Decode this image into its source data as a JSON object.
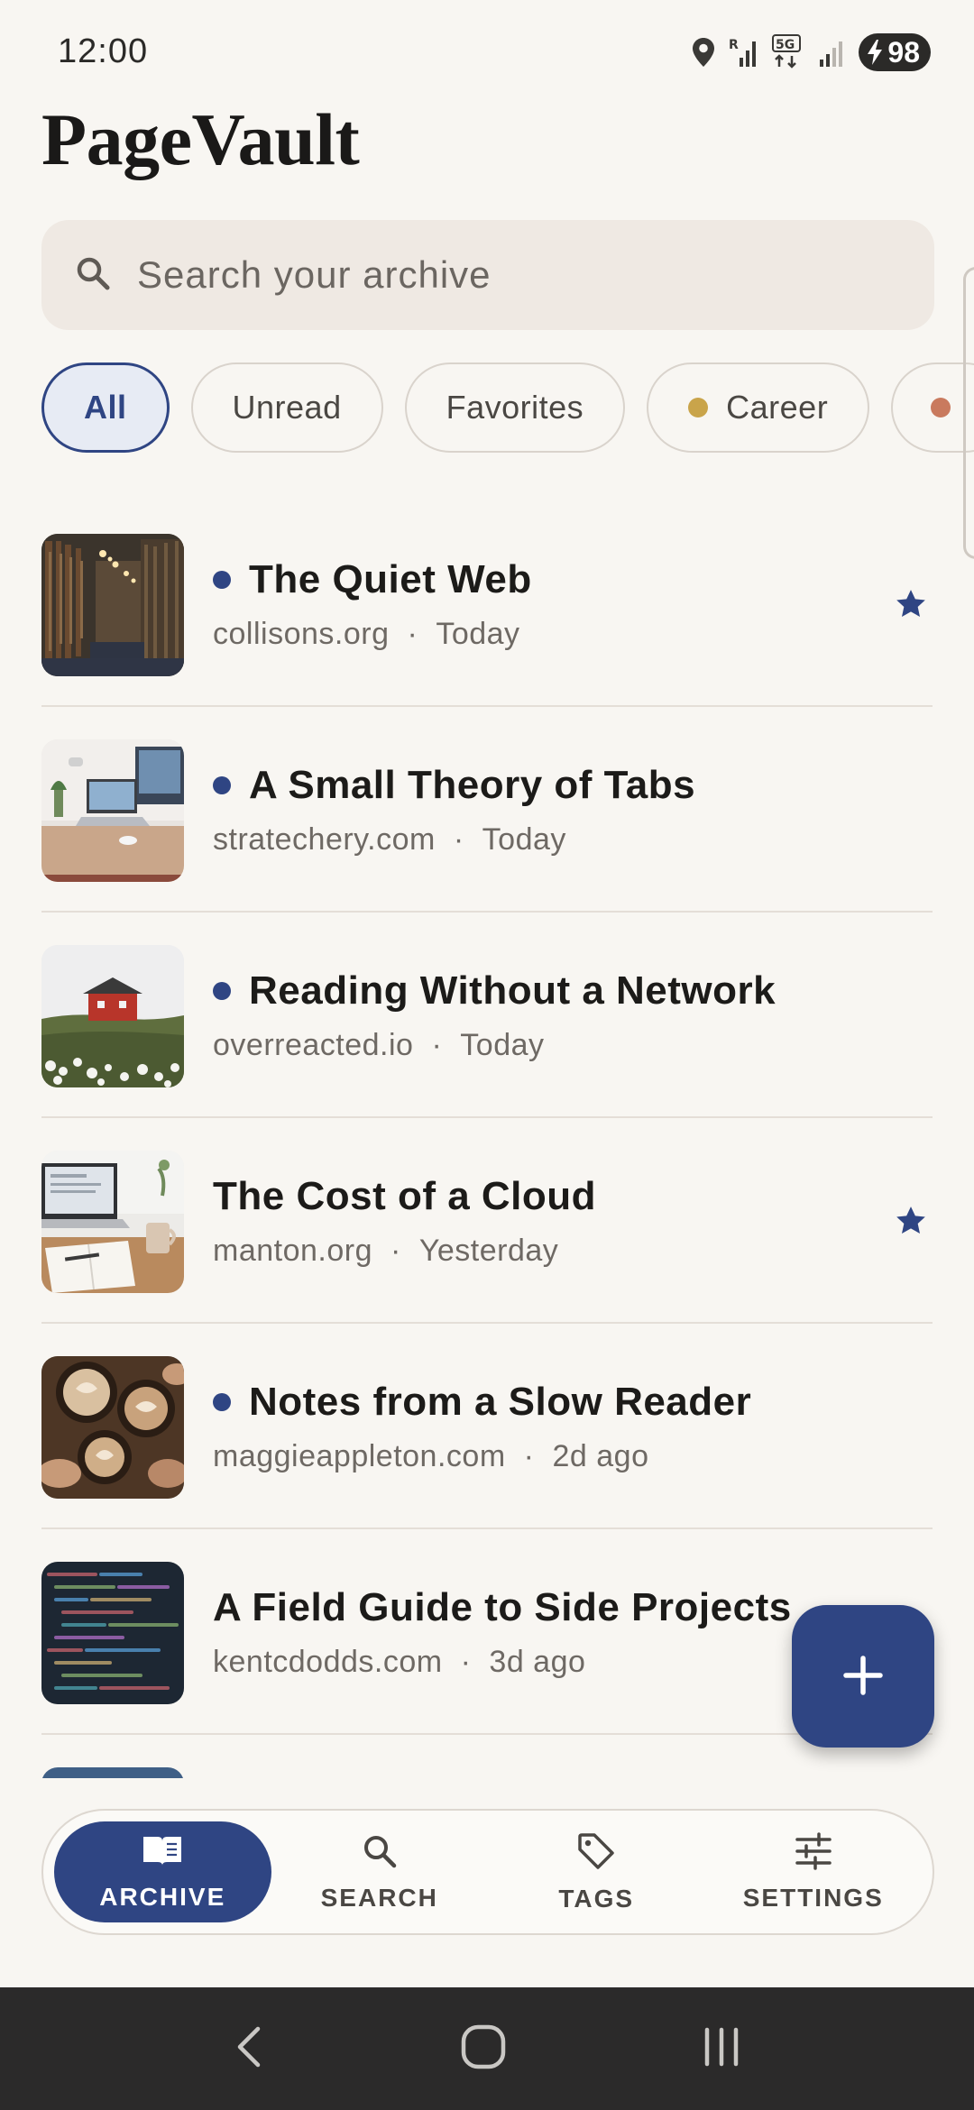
{
  "status_bar": {
    "time": "12:00",
    "battery": "98",
    "icons": [
      "location-icon",
      "signal-roaming-icon",
      "data-5g-icon",
      "signal-weak-icon",
      "battery-charging-icon"
    ]
  },
  "app": {
    "title": "PageVault"
  },
  "search": {
    "placeholder": "Search your archive"
  },
  "filters": [
    {
      "label": "All",
      "selected": true
    },
    {
      "label": "Unread"
    },
    {
      "label": "Favorites"
    },
    {
      "label": "Career",
      "dot_color": "#c9a44a"
    },
    {
      "label": "",
      "dot_color": "#c97a5e"
    }
  ],
  "articles": [
    {
      "title": "The Quiet Web",
      "source": "collisons.org",
      "date": "Today",
      "unread": true,
      "favorite": true,
      "thumb": "library-bookshelves"
    },
    {
      "title": "A Small Theory of Tabs",
      "source": "stratechery.com",
      "date": "Today",
      "unread": true,
      "favorite": false,
      "thumb": "desk-with-laptop"
    },
    {
      "title": "Reading Without a Network",
      "source": "overreacted.io",
      "date": "Today",
      "unread": true,
      "favorite": false,
      "thumb": "red-cabin-field"
    },
    {
      "title": "The Cost of a Cloud",
      "source": "manton.org",
      "date": "Yesterday",
      "unread": false,
      "favorite": true,
      "thumb": "laptop-notebook-coffee"
    },
    {
      "title": "Notes from a Slow Reader",
      "source": "maggieappleton.com",
      "date": "2d ago",
      "unread": true,
      "favorite": false,
      "thumb": "latte-cups"
    },
    {
      "title": "A Field Guide to Side Projects",
      "source": "kentcdodds.com",
      "date": "3d ago",
      "unread": false,
      "favorite": false,
      "thumb": "code-screen"
    }
  ],
  "meta_separator": "·",
  "nav": {
    "archive": "ARCHIVE",
    "search": "SEARCH",
    "tags": "TAGS",
    "settings": "SETTINGS"
  },
  "colors": {
    "accent": "#2f4583",
    "background": "#f8f6f2",
    "career_dot": "#c9a44a"
  }
}
